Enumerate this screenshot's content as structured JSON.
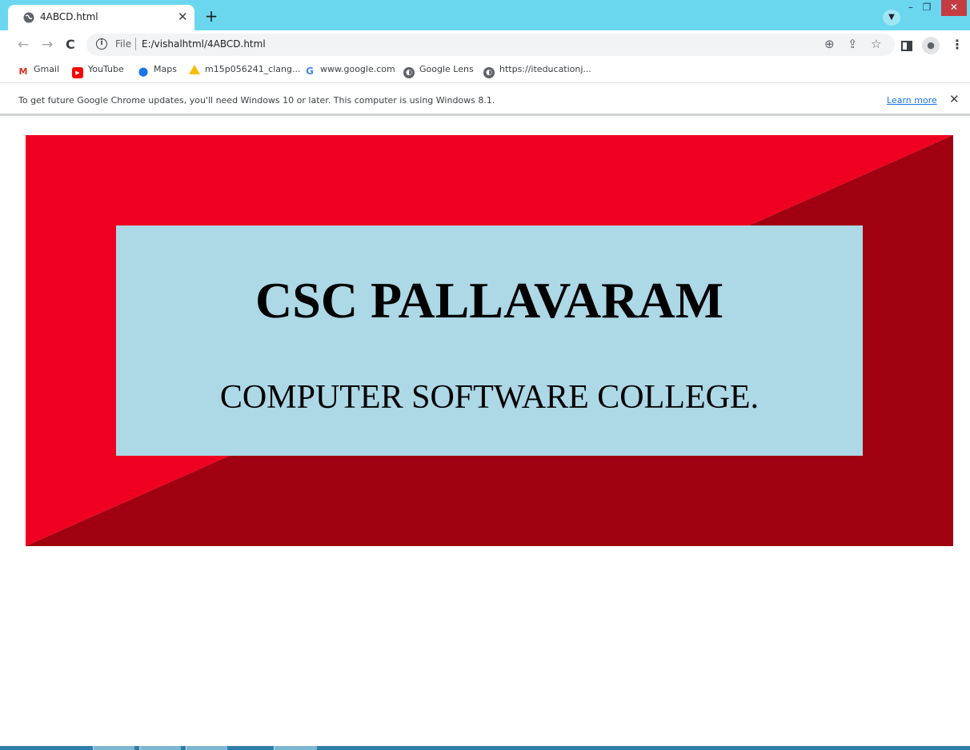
{
  "browser": {
    "tab": {
      "title": "4ABCD.html"
    },
    "toolbar": {
      "scheme_label": "File",
      "url": "E:/vishalhtml/4ABCD.html"
    },
    "bookmarks": [
      {
        "label": "Gmail",
        "icon": "gmail-icon"
      },
      {
        "label": "YouTube",
        "icon": "youtube-icon"
      },
      {
        "label": "Maps",
        "icon": "maps-icon"
      },
      {
        "label": "m15p056241_clang...",
        "icon": "drive-icon"
      },
      {
        "label": "www.google.com",
        "icon": "google-icon"
      },
      {
        "label": "Google Lens",
        "icon": "globe-icon"
      },
      {
        "label": "https://iteducationj...",
        "icon": "globe-icon"
      }
    ],
    "infobar": {
      "message": "To get future Google Chrome updates, you'll need Windows 10 or later. This computer is using Windows 8.1.",
      "link": "Learn more"
    },
    "colors": {
      "tabstrip": "#6ad7ee",
      "win_close": "#c43c42"
    }
  },
  "page": {
    "heading": "CSC PALLAVARAM",
    "subheading": "COMPUTER SOFTWARE COLLEGE.",
    "colors": {
      "border_light": "#f00020",
      "border_dark": "#a00010",
      "inner_background": "#add8e6"
    }
  }
}
